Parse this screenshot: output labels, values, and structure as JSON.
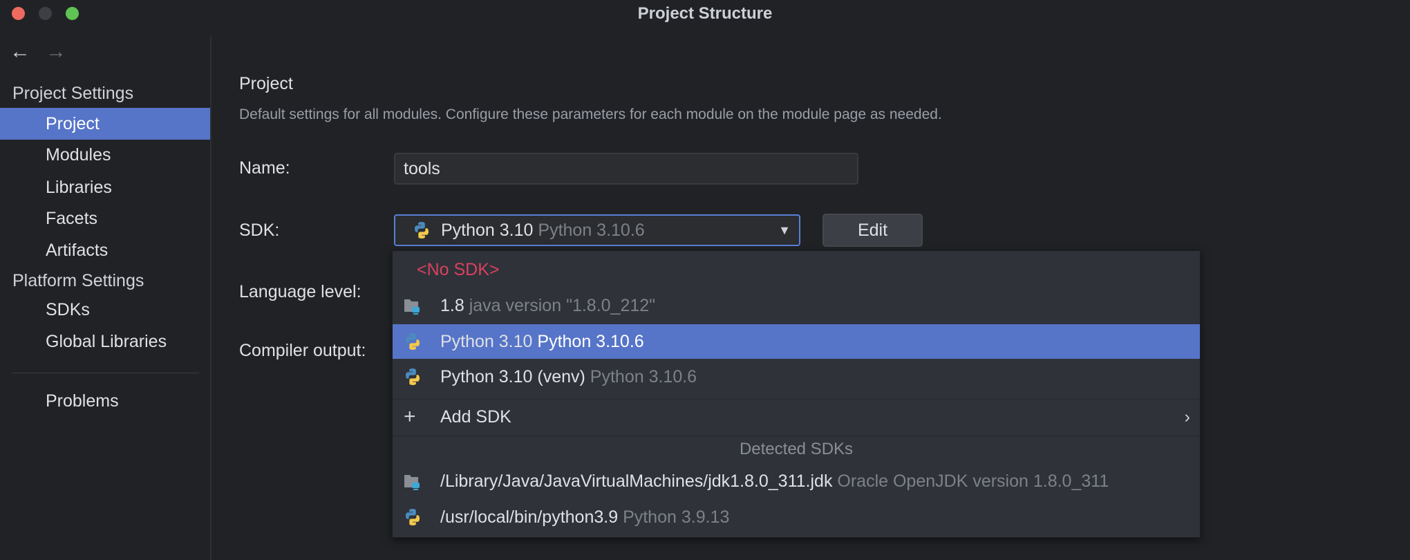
{
  "window": {
    "title": "Project Structure"
  },
  "sidebar": {
    "back_icon": "arrow-left",
    "forward_icon": "arrow-right",
    "sections": [
      {
        "header": "Project Settings",
        "items": [
          "Project",
          "Modules",
          "Libraries",
          "Facets",
          "Artifacts"
        ]
      },
      {
        "header": "Platform Settings",
        "items": [
          "SDKs",
          "Global Libraries"
        ]
      }
    ],
    "problems": "Problems",
    "selected": "Project"
  },
  "main": {
    "heading": "Project",
    "description": "Default settings for all modules. Configure these parameters for each module on the module page as needed.",
    "name_label": "Name:",
    "name_value": "tools",
    "sdk_label": "SDK:",
    "sdk_value": "Python 3.10",
    "sdk_value_detail": "Python 3.10.6",
    "edit_label": "Edit",
    "language_level_label": "Language level:",
    "compiler_output_label": "Compiler output:"
  },
  "sdk_popup": {
    "no_sdk": "<No SDK>",
    "items": [
      {
        "name": "1.8",
        "detail": "java version \"1.8.0_212\"",
        "icon": "jdk-folder"
      },
      {
        "name": "Python 3.10",
        "detail": "Python 3.10.6",
        "icon": "python",
        "selected": true
      },
      {
        "name": "Python 3.10 (venv)",
        "detail": "Python 3.10.6",
        "icon": "python"
      }
    ],
    "add_sdk": "Add SDK",
    "detected_header": "Detected SDKs",
    "detected": [
      {
        "name": "/Library/Java/JavaVirtualMachines/jdk1.8.0_311.jdk",
        "detail": "Oracle OpenJDK version 1.8.0_311",
        "icon": "jdk-folder"
      },
      {
        "name": "/usr/local/bin/python3.9",
        "detail": "Python 3.9.13",
        "icon": "python"
      }
    ]
  },
  "colors": {
    "accent": "#5674c8",
    "error": "#d9415e",
    "background": "#212226",
    "popup": "#30323a"
  }
}
